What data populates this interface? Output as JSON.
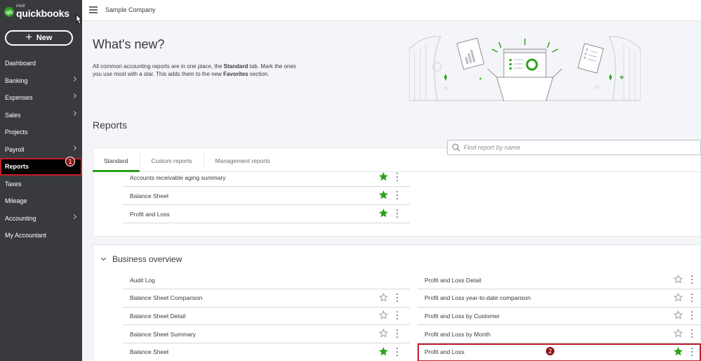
{
  "sidebar": {
    "logo_small": "intuit",
    "logo_name": "quickbooks",
    "new_label": "New",
    "items": [
      {
        "label": "Dashboard",
        "chevron": false
      },
      {
        "label": "Banking",
        "chevron": true
      },
      {
        "label": "Expenses",
        "chevron": true
      },
      {
        "label": "Sales",
        "chevron": true
      },
      {
        "label": "Projects",
        "chevron": false
      },
      {
        "label": "Payroll",
        "chevron": true
      },
      {
        "label": "Reports",
        "chevron": false,
        "active": true
      },
      {
        "label": "Taxes",
        "chevron": false
      },
      {
        "label": "Mileage",
        "chevron": false
      },
      {
        "label": "Accounting",
        "chevron": true
      },
      {
        "label": "My Accountant",
        "chevron": false
      }
    ],
    "reports_badge": "1"
  },
  "topbar": {
    "company": "Sample Company"
  },
  "whats_new": {
    "title": "What's new?",
    "desc_1": "All common accounting reports are in one place, the ",
    "desc_standard": "Standard",
    "desc_2": " tab. Mark the ones you use most with a star. This adds them to the new ",
    "desc_favorites": "Favorites",
    "desc_3": " section."
  },
  "reports": {
    "title": "Reports",
    "search_placeholder": "Find report by name",
    "tabs": [
      "Standard",
      "Custom reports",
      "Management reports"
    ],
    "favorites": [
      {
        "name": "Accounts receivable aging summary",
        "starred": true
      },
      {
        "name": "Balance Sheet",
        "starred": true
      },
      {
        "name": "Profit and Loss",
        "starred": true
      }
    ]
  },
  "business_overview": {
    "title": "Business overview",
    "left": [
      {
        "name": "Audit Log",
        "starred": null
      },
      {
        "name": "Balance Sheet Comparison",
        "starred": false
      },
      {
        "name": "Balance Sheet Detail",
        "starred": false
      },
      {
        "name": "Balance Sheet Summary",
        "starred": false
      },
      {
        "name": "Balance Sheet",
        "starred": true
      }
    ],
    "right": [
      {
        "name": "Profit and Loss Detail",
        "starred": false
      },
      {
        "name": "Profit and Loss year-to-date comparison",
        "starred": false
      },
      {
        "name": "Profit and Loss by Customer",
        "starred": false
      },
      {
        "name": "Profit and Loss by Month",
        "starred": false
      },
      {
        "name": "Profit and Loss",
        "starred": true
      }
    ],
    "badge": "2"
  },
  "colors": {
    "brand_green": "#2ca01c",
    "sidebar_bg": "#393a3d",
    "highlight_red": "#c11d2a",
    "badge_dark_red": "#8b1414"
  }
}
